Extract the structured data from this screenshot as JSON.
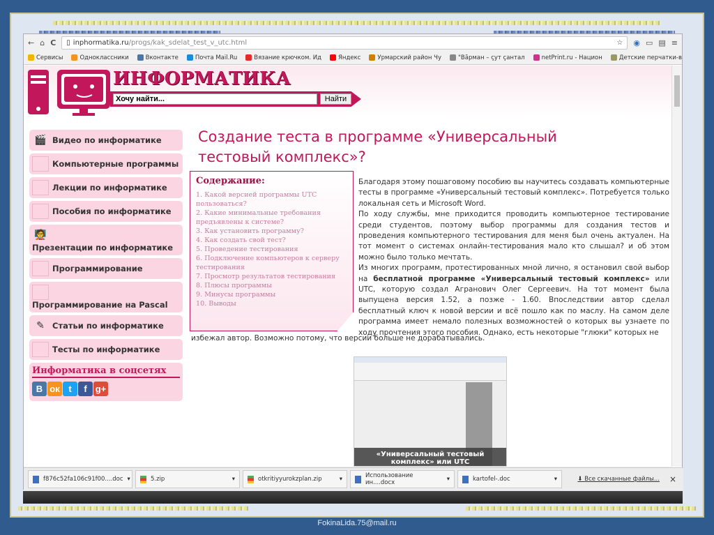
{
  "browser": {
    "url_host": "inphormatika.ru",
    "url_path": "/progs/kak_sdelat_test_v_utc.html",
    "bookmarks": [
      {
        "label": "Сервисы",
        "color": "#f4b400"
      },
      {
        "label": "Одноклассники",
        "color": "#f7931e"
      },
      {
        "label": "Вконтакте",
        "color": "#4a76a8"
      },
      {
        "label": "Почта Mail.Ru",
        "color": "#168de2"
      },
      {
        "label": "Вязание крючком. Ид",
        "color": "#e52d27"
      },
      {
        "label": "Яндекс",
        "color": "#ff0000"
      },
      {
        "label": "Урмарский район Чу",
        "color": "#d08000"
      },
      {
        "label": "\"Вăрман – çут çантал",
        "color": "#888888"
      },
      {
        "label": "netPrint.ru - Национ",
        "color": "#d0328c"
      },
      {
        "label": "Детские перчатки-в",
        "color": "#999966"
      }
    ],
    "more": "»"
  },
  "site": {
    "title": "ИНФОРМАТИКА",
    "search_value": "Хочу найти...",
    "search_button": "Найти",
    "nav": [
      "Видео по информатике",
      "Компьютерные программы",
      "Лекции по информатике",
      "Пособия по информатике",
      "Презентации по информатике",
      "Программирование",
      "Программирование на Pascal",
      "Статьи по информатике",
      "Тесты по информатике"
    ],
    "social_title": "Информатика в соцсетях",
    "social": [
      {
        "label": "В",
        "color": "#4a76a8"
      },
      {
        "label": "ок",
        "color": "#f7931e"
      },
      {
        "label": "t",
        "color": "#1da1f2"
      },
      {
        "label": "f",
        "color": "#3b5998"
      },
      {
        "label": "g+",
        "color": "#dd4b39"
      }
    ]
  },
  "article": {
    "title": "Создание теста в программе «Универсальный тестовый комплекс»?",
    "toc_title": "Содержание:",
    "toc": [
      "1. Какой версией программы UTC пользоваться?",
      "2. Какие минимальные требования предъявлены к системе?",
      "3. Как установить программу?",
      "4. Как создать свой тест?",
      "5. Проведение тестирования",
      "6. Подключение компьютеров к серверу тестирования",
      "7. Просмотр результатов тестирования",
      "8. Плюсы программы",
      "9. Минусы программы",
      "10. Выводы"
    ],
    "p1": "Благодаря этому пошаговому пособию вы научитесь создавать компьютерные тесты в программе «Универсальный тестовый комплекс». Потребуется только локальная сеть и Microsoft Word.",
    "p2": "По ходу службы, мне приходится проводить компьютерное тестирование среди студентов, поэтому выбор программы для создания тестов и проведения компьютерного тестирования для меня был очень актуален. На тот момент о системах онлайн-тестирования мало кто слышал? и об этом можно было только мечтать.",
    "p3a": "Из многих программ, протестированных мной лично, я остановил свой выбор на ",
    "p3b": "бесплатной программе «Универсальный тестовый комплекс»",
    "p3c": " или UTC, которую создал Агранович Олег Сергеевич. На тот момент была выпущена версия 1.52, а позже - 1.60. Впоследствии автор сделал бесплатный ключ к новой версии и всё пошло как по маслу. На самом деле программа имеет немало полезных возможностей о которых вы узнаете по ходу прочтения этого пособия. Однако, есть некоторые \"глюки\" которых не",
    "p3d": "избежал автор. Возможно потому, что версии больше не дорабатывались.",
    "image_caption": "«Универсальный тестовый комплекс» или UTC"
  },
  "downloads": {
    "items": [
      {
        "name": "f876c52fa106c91f00....doc",
        "type": "doc"
      },
      {
        "name": "5.zip",
        "type": "zip"
      },
      {
        "name": "otkritiyyurokzplan.zip",
        "type": "zip"
      },
      {
        "name": "Использование ин....docx",
        "type": "doc"
      },
      {
        "name": "kartofel-.doc",
        "type": "doc"
      }
    ],
    "all": "Все скачанные файлы...",
    "close": "×"
  },
  "footer": "FokinaLida.75@mail.ru"
}
